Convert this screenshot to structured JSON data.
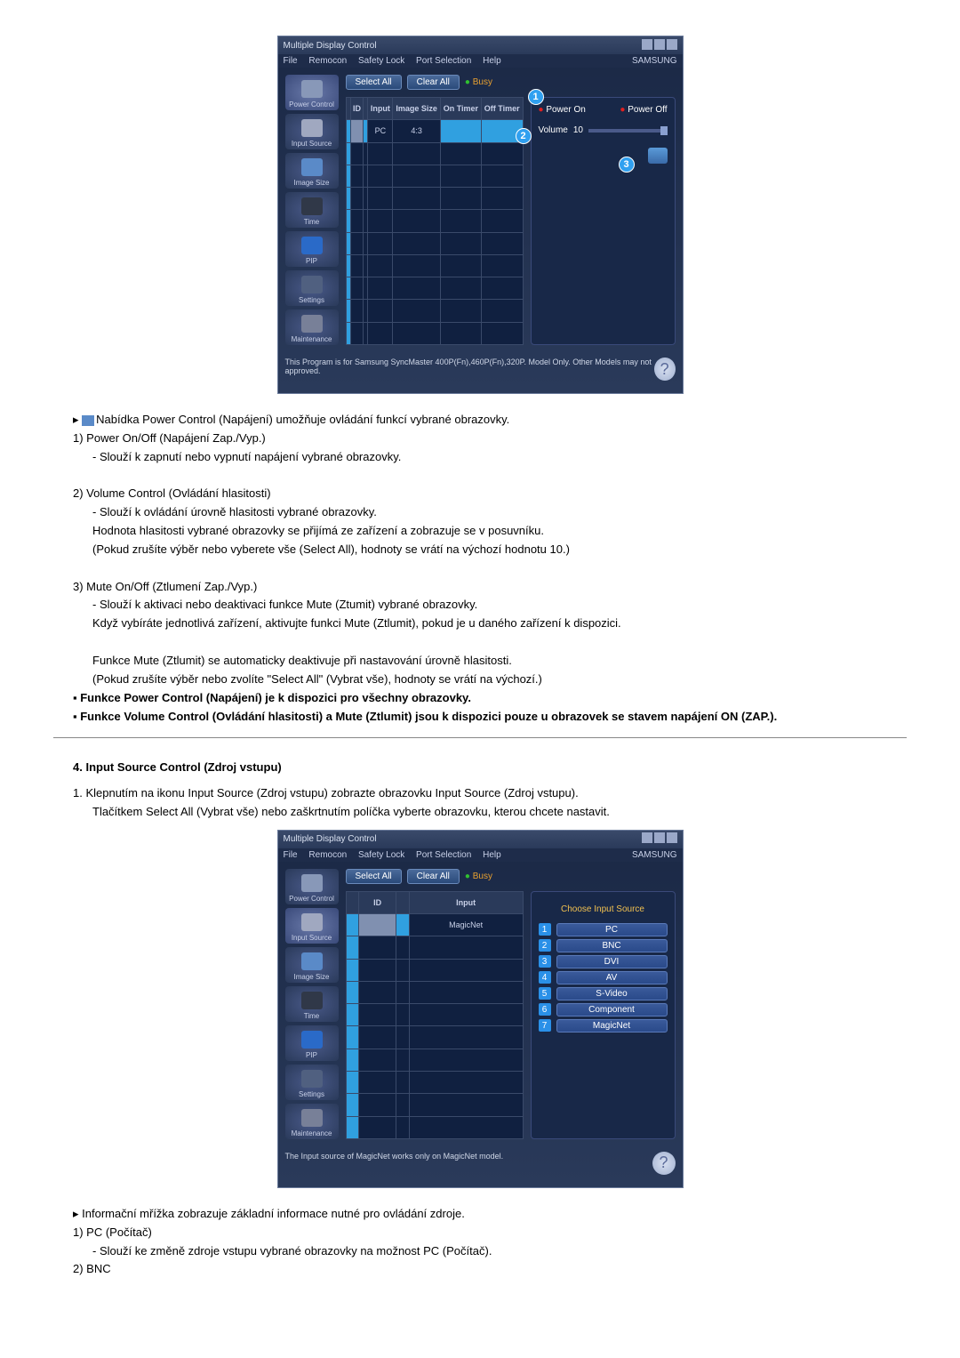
{
  "app": {
    "title": "Multiple Display Control",
    "brand": "SAMSUNG"
  },
  "menu": {
    "file": "File",
    "remocon": "Remocon",
    "safety": "Safety Lock",
    "port": "Port Selection",
    "help": "Help"
  },
  "sidebar": {
    "power": "Power Control",
    "input": "Input Source",
    "image": "Image Size",
    "time": "Time",
    "pip": "PIP",
    "settings": "Settings",
    "maint": "Maintenance"
  },
  "buttons": {
    "select_all": "Select All",
    "clear_all": "Clear All",
    "busy": "Busy"
  },
  "grid1": {
    "headers": [
      "",
      "ID",
      "",
      "Input",
      "Image Size",
      "On Timer",
      "Off Timer"
    ],
    "row1_input": "PC",
    "row1_size": "4:3"
  },
  "grid2": {
    "headers": [
      "",
      "ID",
      "",
      "Input"
    ],
    "row1_input": "MagicNet"
  },
  "power_panel": {
    "on": "Power On",
    "off": "Power Off",
    "volume_label": "Volume",
    "volume_value": "10"
  },
  "callouts": {
    "c1": "1",
    "c2": "2",
    "c3": "3"
  },
  "source_panel": {
    "title": "Choose Input Source",
    "items": [
      {
        "n": "1",
        "label": "PC"
      },
      {
        "n": "2",
        "label": "BNC"
      },
      {
        "n": "3",
        "label": "DVI"
      },
      {
        "n": "4",
        "label": "AV"
      },
      {
        "n": "5",
        "label": "S-Video"
      },
      {
        "n": "6",
        "label": "Component"
      },
      {
        "n": "7",
        "label": "MagicNet"
      }
    ]
  },
  "footer1": "This Program is for Samsung SyncMaster 400P(Fn),460P(Fn),320P. Model Only. Other Models may not approved.",
  "footer2": "The Input source of MagicNet works only on MagicNet model.",
  "doc": {
    "p_intro": "Nabídka Power Control (Napájení) umožňuje ovládání funkcí vybrané obrazovky.",
    "p1": "1)  Power On/Off (Napájení Zap./Vyp.)",
    "p1a": "Slouží k zapnutí nebo vypnutí napájení vybrané obrazovky.",
    "p2": "2)  Volume Control (Ovládání hlasitosti)",
    "p2a": "Slouží k ovládání úrovně hlasitosti vybrané obrazovky.",
    "p2b": "Hodnota hlasitosti vybrané obrazovky se přijímá ze zařízení a zobrazuje se v posuvníku.",
    "p2c": "(Pokud zrušíte výběr nebo vyberete vše (Select All), hodnoty se vrátí na výchozí hodnotu 10.)",
    "p3": "3)  Mute On/Off (Ztlumení Zap./Vyp.)",
    "p3a": "Slouží k aktivaci nebo deaktivaci funkce Mute (Ztumit) vybrané obrazovky.",
    "p3b": "Když vybíráte jednotlivá zařízení, aktivujte funkci Mute (Ztlumit), pokud je u daného zařízení k dispozici.",
    "p3c": "Funkce Mute (Ztlumit) se automaticky deaktivuje při nastavování úrovně hlasitosti.",
    "p3d": "(Pokud zrušíte výběr nebo zvolíte \"Select All\" (Vybrat vše), hodnoty se vrátí na výchozí.)",
    "note1": "Funkce Power Control (Napájení) je k dispozici pro všechny obrazovky.",
    "note2": "Funkce Volume Control (Ovládání hlasitosti) a Mute (Ztlumit) jsou k dispozici pouze u obrazovek se stavem napájení ON (ZAP.).",
    "sec4": "4. Input Source Control (Zdroj vstupu)",
    "s4_1": "1.  Klepnutím na ikonu Input Source (Zdroj vstupu) zobrazte obrazovku Input Source (Zdroj vstupu).",
    "s4_1b": "Tlačítkem Select All (Vybrat vše) nebo zaškrtnutím políčka vyberte obrazovku, kterou chcete nastavit.",
    "s4_info": "Informační mřížka zobrazuje základní informace nutné pro ovládání zdroje.",
    "s4_p1": "1)  PC (Počítač)",
    "s4_p1a": "Slouží ke změně zdroje vstupu vybrané obrazovky na možnost PC (Počítač).",
    "s4_p2": "2)  BNC"
  }
}
